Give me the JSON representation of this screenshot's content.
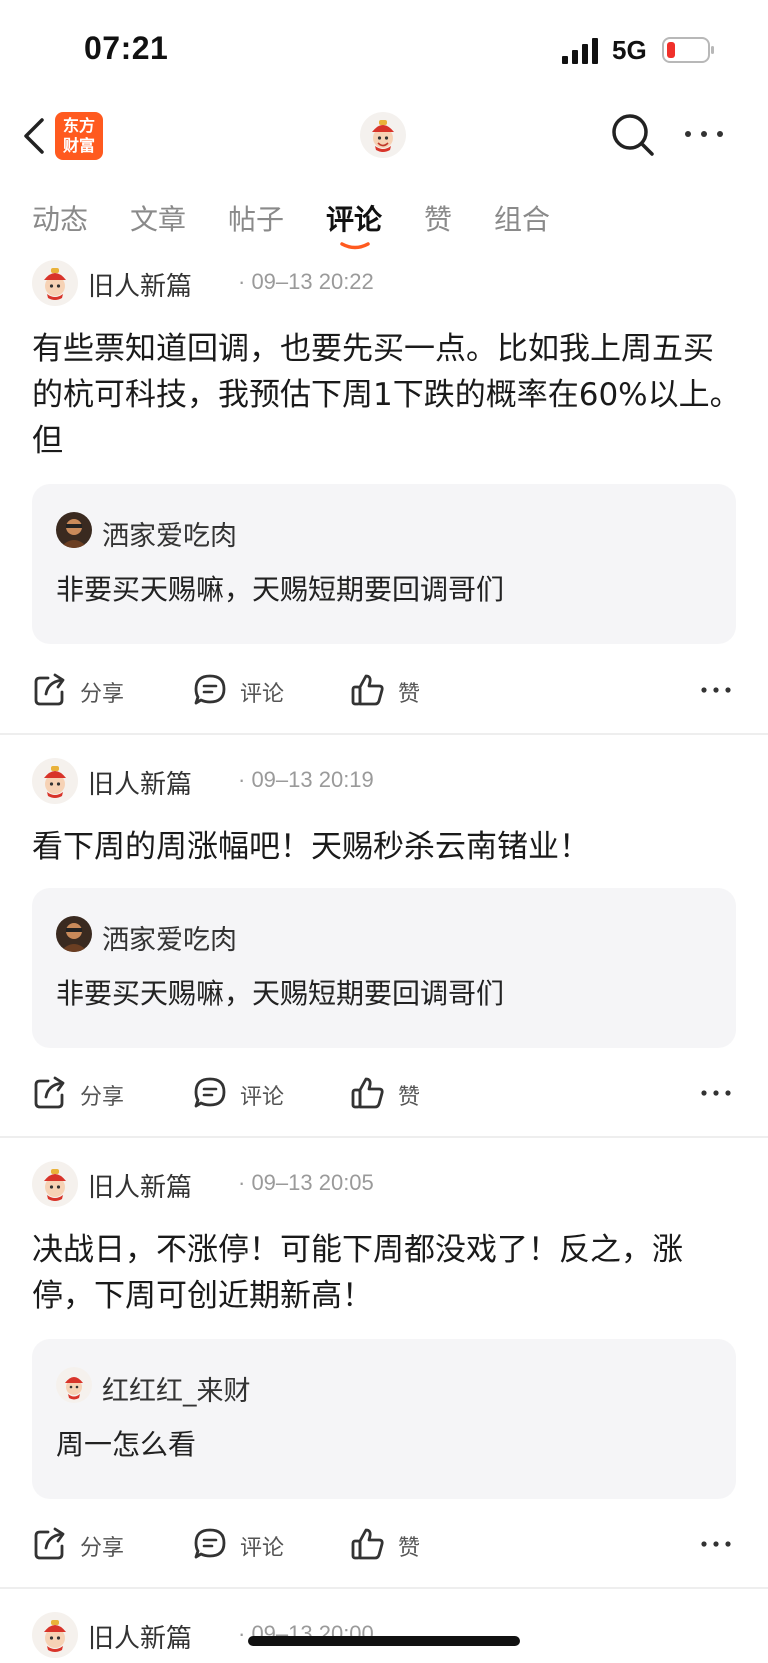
{
  "status_bar": {
    "time": "07:21",
    "network": "5G"
  },
  "header": {
    "logo_line1": "东方",
    "logo_line2": "财富"
  },
  "tabs": [
    {
      "label": "动态",
      "active": false
    },
    {
      "label": "文章",
      "active": false
    },
    {
      "label": "帖子",
      "active": false
    },
    {
      "label": "评论",
      "active": true
    },
    {
      "label": "赞",
      "active": false
    },
    {
      "label": "组合",
      "active": false
    }
  ],
  "actions": {
    "share": "分享",
    "comment": "评论",
    "like": "赞"
  },
  "posts": [
    {
      "author": "旧人新篇",
      "time": "· 09–13 20:22",
      "text": "有些票知道回调，也要先买一点。比如我上周五买的杭可科技，我预估下周1下跌的概率在60%以上。但",
      "quote": {
        "user": "洒家爱吃肉",
        "text": "非要买天赐嘛，天赐短期要回调哥们"
      }
    },
    {
      "author": "旧人新篇",
      "time": "· 09–13 20:19",
      "text": "看下周的周涨幅吧！天赐秒杀云南锗业！",
      "quote": {
        "user": "洒家爱吃肉",
        "text": "非要买天赐嘛，天赐短期要回调哥们"
      }
    },
    {
      "author": "旧人新篇",
      "time": "· 09–13 20:05",
      "text": "决战日，不涨停！可能下周都没戏了！反之，涨停，下周可创近期新高！",
      "quote": {
        "user": "红红红_来财",
        "text": "周一怎么看"
      }
    },
    {
      "author": "旧人新篇",
      "time": "· 09–13 20:00"
    }
  ],
  "colors": {
    "brand": "#ff5a1f",
    "tab_underline": "#ff5a1f",
    "quote_bg": "#f5f5f7"
  }
}
